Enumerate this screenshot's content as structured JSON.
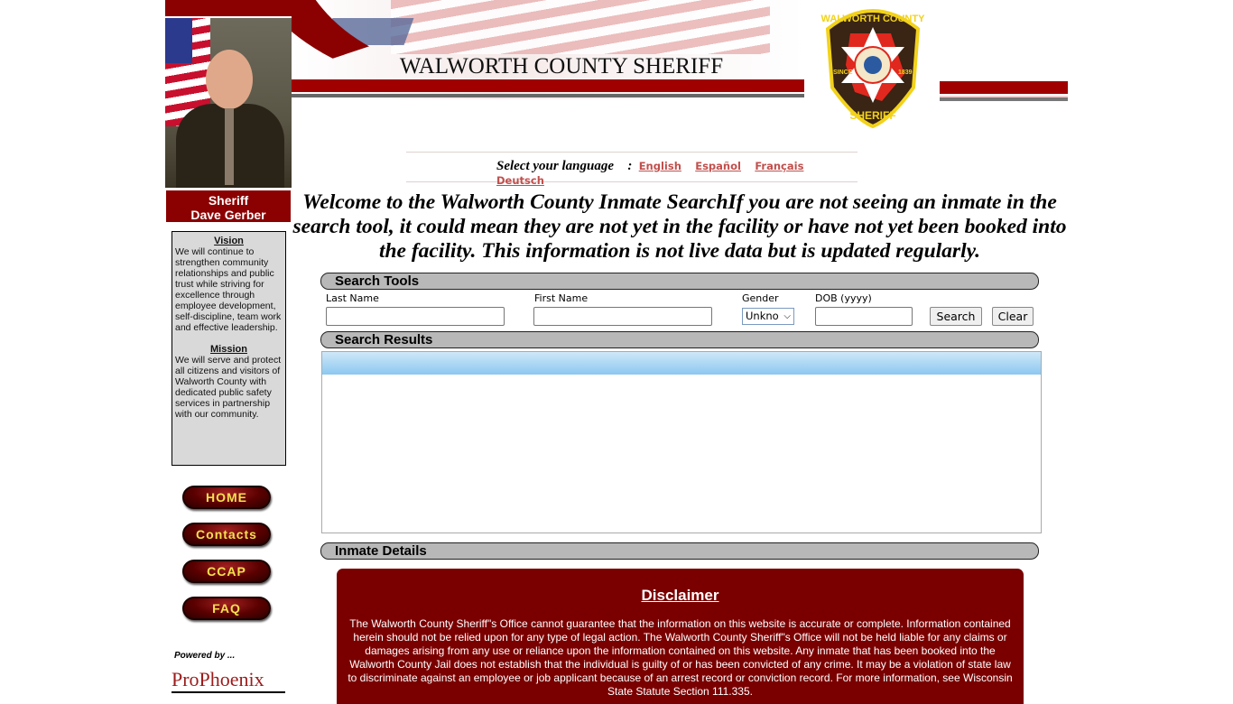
{
  "header": {
    "title": "WALWORTH COUNTY SHERIFF",
    "badge": {
      "top": "WALWORTH COUNTY",
      "left": "SINCE",
      "right": "1839",
      "bottom": "SHERIFF"
    }
  },
  "sidebar": {
    "caption_line1": "Sheriff",
    "caption_line2": "Dave Gerber",
    "vision_title": "Vision",
    "vision_text": "We will continue to strengthen community relationships and public trust while striving for excellence through employee development, self-discipline, team work and effective leadership.",
    "mission_title": "Mission",
    "mission_text": "We will serve and protect all citizens and visitors of Walworth County with dedicated public safety services in partnership with our community.",
    "nav": [
      {
        "label": "HOME"
      },
      {
        "label": "Contacts"
      },
      {
        "label": "CCAP"
      },
      {
        "label": "FAQ"
      }
    ],
    "powered_by": "Powered by ...",
    "vendor_logo": "ProPhoenix"
  },
  "language": {
    "label": "Select your language",
    "sep": ":",
    "options": [
      "English",
      "Español",
      "Français",
      "Deutsch"
    ]
  },
  "welcome": "Welcome to the Walworth County Inmate SearchIf you are not seeing an inmate in the search tool, it could mean they are not yet in the facility or have not yet been booked into the facility. This information is not live data but is updated regularly.",
  "search_tools": {
    "title": "Search Tools",
    "last_name_label": "Last Name",
    "last_name_value": "",
    "first_name_label": "First Name",
    "first_name_value": "",
    "gender_label": "Gender",
    "gender_value": "Unkno",
    "dob_label": "DOB (yyyy)",
    "dob_value": "",
    "search_button": "Search",
    "clear_button": "Clear"
  },
  "search_results": {
    "title": "Search Results"
  },
  "inmate_details": {
    "title": "Inmate Details"
  },
  "disclaimer": {
    "title": "Disclaimer",
    "text": "The Walworth County Sheriff\"s Office cannot guarantee that the information on this website is accurate or complete.  Information contained herein should not be relied upon for any type of legal action.  The Walworth County Sheriff\"s Office will not be held liable for any claims or damages arising from any use or reliance upon the information contained on this website.  Any inmate that has been booked into the Walworth County Jail does not establish that the individual is guilty of or has been convicted of any crime.  It may be a violation of state law to discriminate against an employee or job applicant because of an arrest record or conviction record.  For more information, see Wisconsin State Statute Section 111.335."
  },
  "colors": {
    "brand_red": "#8b0000",
    "disclaimer_bg": "#7a0000",
    "nav_text": "#f5e050",
    "bar_gray": "#b8b8b8",
    "link": "#c0504d"
  }
}
